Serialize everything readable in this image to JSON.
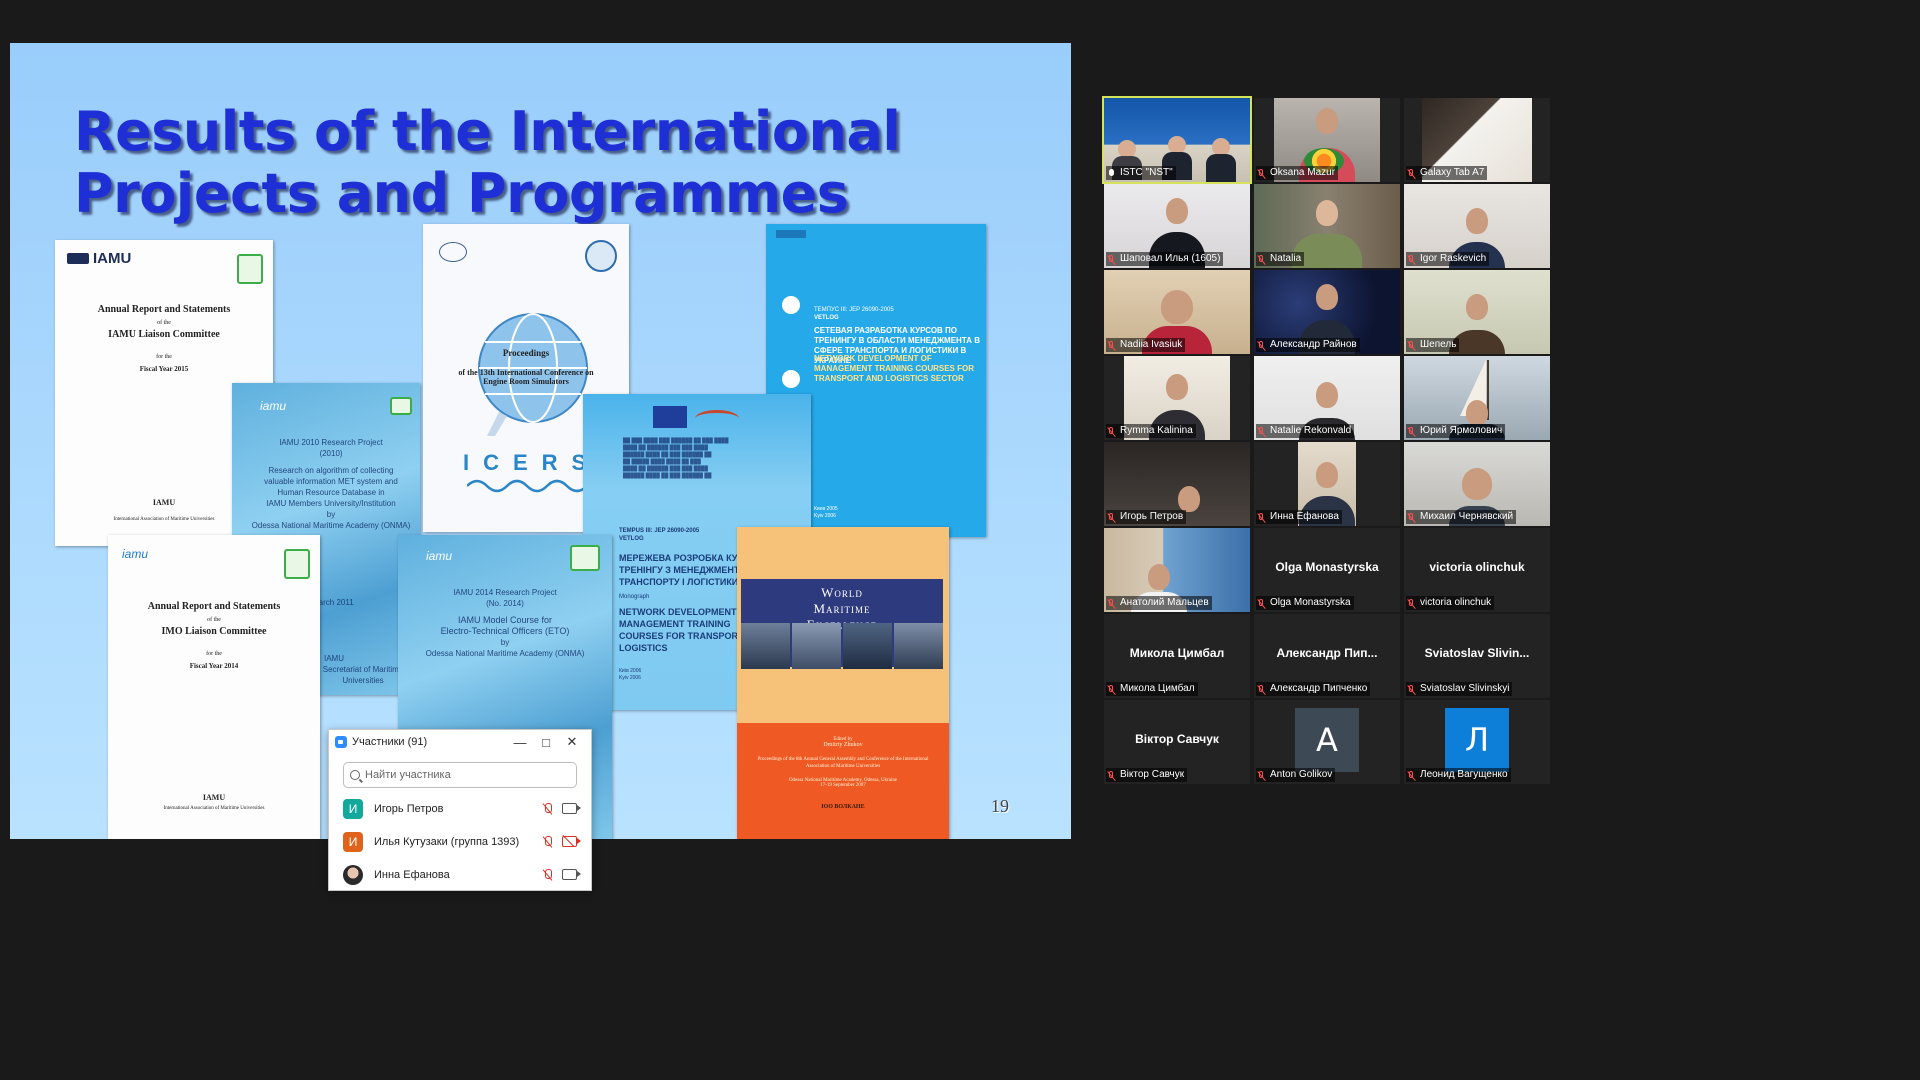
{
  "slide": {
    "title": "Results of the International\nProjects and Programmes",
    "page_number": "19",
    "doc1": {
      "logo": "IAMU",
      "title": "Annual Report and Statements",
      "of": "of the",
      "committee": "IAMU Liaison Committee",
      "for": "for the",
      "year": "Fiscal Year 2015",
      "footer_logo": "IAMU",
      "footer": "International Association of Maritime Universities"
    },
    "doc2": {
      "logo": "iamu",
      "lines": [
        "IAMU 2010 Research Project",
        "(2010)",
        "Research on algorithm of collecting",
        "valuable information MET system and",
        "Human Resource Database in",
        "IAMU Members University/Institution",
        "by",
        "Odessa National Maritime Academy (ONMA)"
      ],
      "date": "March 2011",
      "footer": "IAMU",
      "footer2": "Secretariat of Maritime Universities"
    },
    "doc3": {
      "proceedings": "Proceedings",
      "of_line": "of the 13th International Conference on",
      "subtitle": "Engine Room Simulators",
      "brand": "ICERS"
    },
    "doc4": {
      "header_lines": [
        "ТЕМПУС III: JEP 26090-2005",
        "VETLOG"
      ],
      "title_ru": "СЕТЕВАЯ РАЗРАБОТКА КУРСОВ ПО ТРЕНИНГУ В ОБЛАСТИ МЕНЕДЖМЕНТА В СФЕРЕ ТРАНСПОРТА И ЛОГИСТИКИ В УКРАИНЕ",
      "title_en": "NETWORK DEVELOPMENT OF MANAGEMENT TRAINING COURSES FOR TRANSPORT AND LOGISTICS SECTOR",
      "place": "Киев 2005",
      "year": "Kyiv 2006"
    },
    "doc5": {
      "header": "TEMPUS III: JEP 26090-2005",
      "vetlog": "VETLOG",
      "title_ua": "МЕРЕЖЕВА РОЗРОБКА КУРСІВ ТРЕНІНГУ З МЕНЕДЖМЕНТУ ТРАНСПОРТУ І ЛОГІСТИКИ",
      "title_en": "NETWORK DEVELOPMENT OF MANAGEMENT TRAINING COURSES FOR TRANSPORT AND LOGISTICS",
      "monograph": "Monograph",
      "place": "Київ 2006",
      "year": "Kyiv 2006"
    },
    "doc6": {
      "logo": "iamu",
      "title": "Annual Report and Statements",
      "of": "of the",
      "committee": "IMO Liaison Committee",
      "for": "for the",
      "year": "Fiscal Year 2014",
      "footer_logo": "IAMU",
      "footer": "International Association of Maritime Universities"
    },
    "doc7": {
      "logo": "iamu",
      "lines": [
        "IAMU 2014 Research Project",
        "(No. 2014)",
        "IAMU Model Course for",
        "Electro-Technical Officers (ETO)",
        "by",
        "Odessa National Maritime Academy (ONMA)"
      ]
    },
    "doc8": {
      "title_lines": [
        "World",
        "Maritime",
        "Excellence"
      ],
      "edited": "Edited by",
      "editor": "Dmitriy Zhukov",
      "proceedings": "Proceedings of the 8th Annual General Assembly and Conference of the International Association of Maritime Universities",
      "place": "Odessa National Maritime Academy, Odessa, Ukraine",
      "date": "17-19 September 2007",
      "publisher": "ЮО ВОЛКАНЕ"
    }
  },
  "participants_panel": {
    "title": "Участники (91)",
    "search_placeholder": "Найти участника",
    "rows": [
      {
        "initial": "И",
        "color": "#12a89b",
        "name": "Игорь Петров",
        "cam_off": false
      },
      {
        "initial": "И",
        "color": "#e0631c",
        "name": "Илья Кутузаки (группа 1393)",
        "cam_off": true
      },
      {
        "initial": "",
        "color": "#333333",
        "name": "Инна Ефанова",
        "cam_off": false
      }
    ]
  },
  "gallery": [
    {
      "name": "ISTC \"NST\"",
      "muted": false,
      "type": "video",
      "active": true
    },
    {
      "name": "Oksana Mazur",
      "muted": true,
      "type": "video"
    },
    {
      "name": "Galaxy Tab A7",
      "muted": true,
      "type": "video"
    },
    {
      "name": "Шаповал Илья (1605)",
      "muted": true,
      "type": "video"
    },
    {
      "name": "Natalia",
      "muted": true,
      "type": "video"
    },
    {
      "name": "Igor Raskevich",
      "muted": true,
      "type": "video"
    },
    {
      "name": "Nadiia Ivasiuk",
      "muted": true,
      "type": "video"
    },
    {
      "name": "Александр Райнов",
      "muted": true,
      "type": "video"
    },
    {
      "name": "Шепель",
      "muted": true,
      "type": "video"
    },
    {
      "name": "Rymma Kalinina",
      "muted": true,
      "type": "video"
    },
    {
      "name": "Natalie Rekonvald",
      "muted": true,
      "type": "video"
    },
    {
      "name": "Юрий Ярмолович",
      "muted": true,
      "type": "video"
    },
    {
      "name": "Игорь Петров",
      "muted": true,
      "type": "video"
    },
    {
      "name": "Инна Ефанова",
      "muted": true,
      "type": "video"
    },
    {
      "name": "Михаил Чернявский",
      "muted": true,
      "type": "video"
    },
    {
      "name": "Анатолий Мальцев",
      "muted": true,
      "type": "video"
    },
    {
      "name": "Olga Monastyrska",
      "big_name": "Olga Monastyrska",
      "muted": true,
      "type": "name"
    },
    {
      "name": "victoria olinchuk",
      "big_name": "victoria olinchuk",
      "muted": true,
      "type": "name"
    },
    {
      "name": "Микола Цимбал",
      "big_name": "Микола Цимбал",
      "muted": true,
      "type": "name"
    },
    {
      "name": "Александр Пипченко",
      "big_name": "Александр  Пип...",
      "muted": true,
      "type": "name"
    },
    {
      "name": "Sviatoslav Slivinskyi",
      "big_name": "Sviatoslav  Slivin...",
      "muted": true,
      "type": "name"
    },
    {
      "name": "Віктор Савчук",
      "big_name": "Віктор Савчук",
      "muted": true,
      "type": "name"
    },
    {
      "name": "Anton Golikov",
      "muted": true,
      "type": "avatar",
      "letter": "A",
      "avatar_color": "#3d4a55"
    },
    {
      "name": "Леонид Вагущенко",
      "muted": true,
      "type": "avatar",
      "letter": "Л",
      "avatar_color": "#0e7fd8"
    }
  ]
}
